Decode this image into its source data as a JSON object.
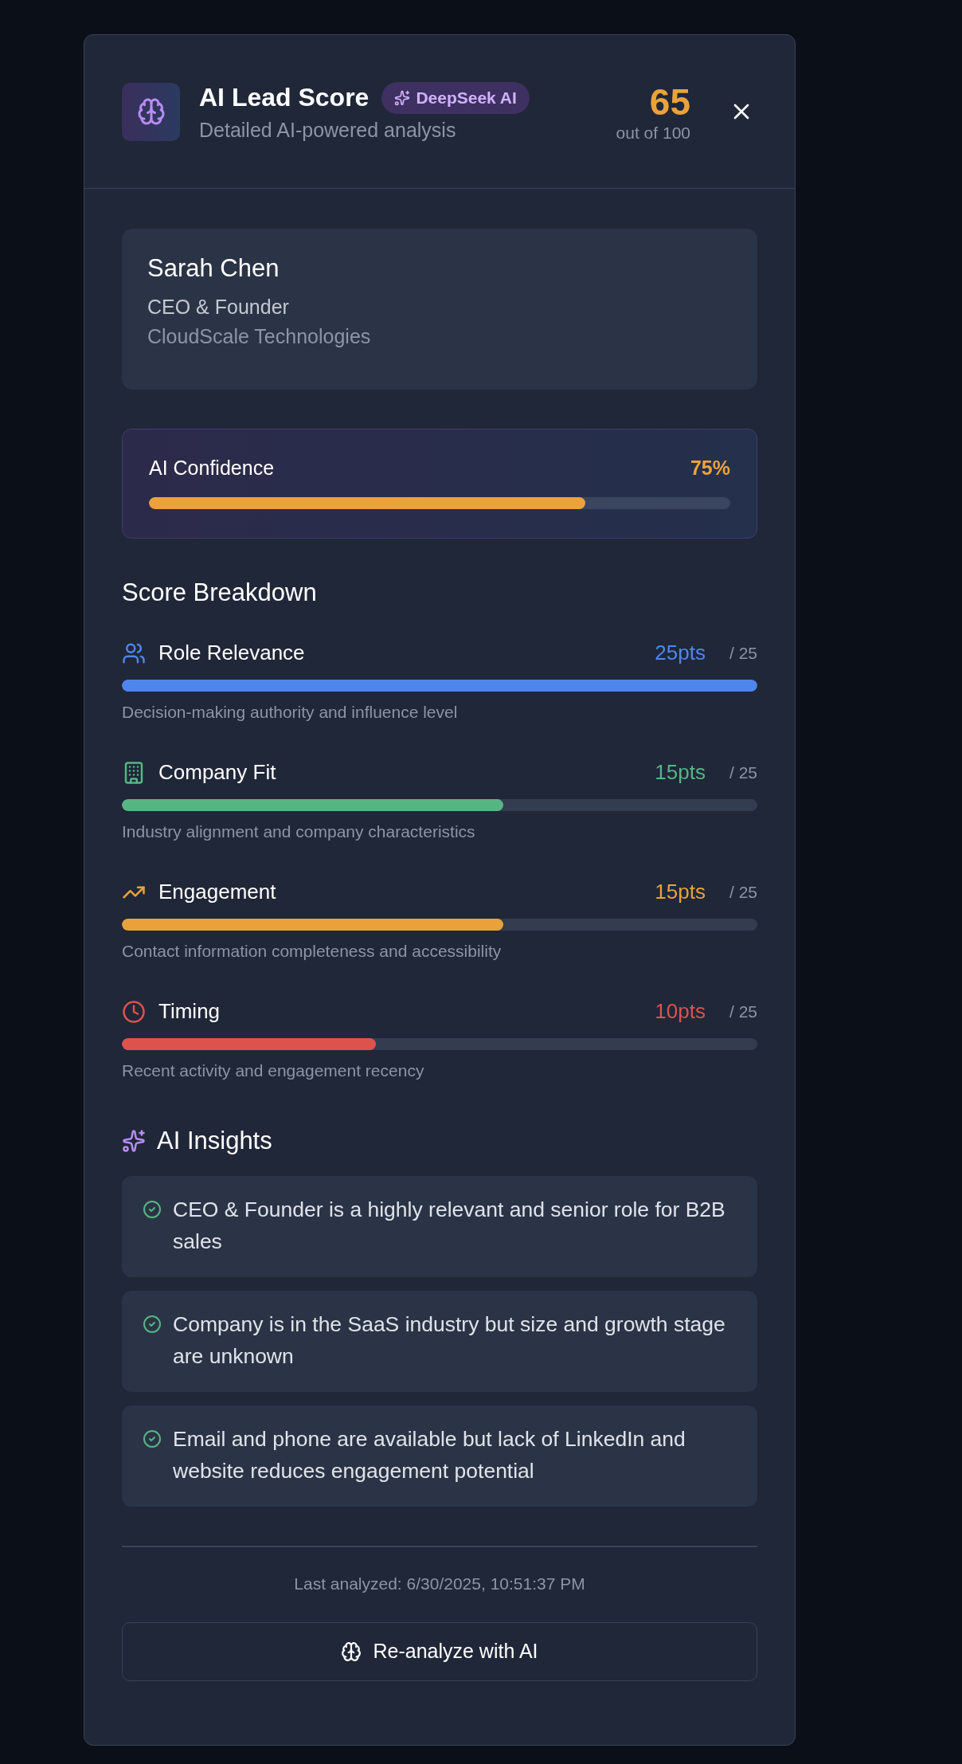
{
  "header": {
    "title": "AI Lead Score",
    "badge": "DeepSeek AI",
    "subtitle": "Detailed AI-powered analysis",
    "score": "65",
    "score_caption": "out of 100"
  },
  "lead": {
    "name": "Sarah Chen",
    "role": "CEO & Founder",
    "company": "CloudScale Technologies"
  },
  "confidence": {
    "label": "AI Confidence",
    "reading": "75%",
    "level": 0.75
  },
  "breakdown": {
    "title": "Score Breakdown",
    "items": [
      {
        "label": "Role Relevance",
        "points": "25pts",
        "max": "/ 25",
        "level": 1.0,
        "color": "#4f86ed",
        "description": "Decision-making authority and influence level"
      },
      {
        "label": "Company Fit",
        "points": "15pts",
        "max": "/ 25",
        "level": 0.6,
        "color": "#57b584",
        "description": "Industry alignment and company characteristics"
      },
      {
        "label": "Engagement",
        "points": "15pts",
        "max": "/ 25",
        "level": 0.6,
        "color": "#e9a23b",
        "description": "Contact information completeness and accessibility"
      },
      {
        "label": "Timing",
        "points": "10pts",
        "max": "/ 25",
        "level": 0.4,
        "color": "#de524d",
        "description": "Recent activity and engagement recency"
      }
    ]
  },
  "insights": {
    "title": "AI Insights",
    "items": [
      "CEO & Founder is a highly relevant and senior role for B2B sales",
      "Company is in the SaaS industry but size and growth stage are unknown",
      "Email and phone are available but lack of LinkedIn and website reduces engagement potential"
    ]
  },
  "footer": {
    "last_analyzed": "Last analyzed: 6/30/2025, 10:51:37 PM",
    "button": "Re-analyze with AI"
  }
}
